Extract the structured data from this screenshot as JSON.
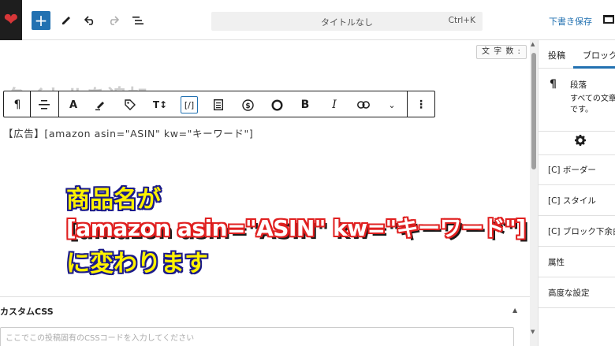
{
  "topbar": {
    "command_title": "タイトルなし",
    "shortcut": "Ctrl+K",
    "save_draft": "下書き保存"
  },
  "editor": {
    "word_count_label": "文 字 数 :",
    "title_placeholder": "タイトルを追加",
    "shortcode_text": "【広告】[amazon asin=\"ASIN\" kw=\"キーワード\"]"
  },
  "block_toolbar": {
    "items": [
      "paragraph",
      "align",
      "text-color",
      "highlighter",
      "tag",
      "font-size",
      "shortcode",
      "list",
      "currency",
      "circle",
      "bold",
      "italic",
      "link",
      "more",
      "options"
    ]
  },
  "overlay_caption": {
    "line1": "商品名が",
    "line2": "[amazon asin=\"ASIN\" kw=\"キーワード\"]",
    "line3": "に変わります"
  },
  "custom_css": {
    "label": "カスタムCSS",
    "placeholder": "ここでこの投稿固有のCSSコードを入力してください"
  },
  "sidebar": {
    "tab_post": "投稿",
    "tab_block": "ブロック",
    "block_name": "段落",
    "block_desc_1": "すべての文章",
    "block_desc_2": "です。",
    "panels": [
      "[C] ボーダー",
      "[C] スタイル",
      "[C] ブロック下余白",
      "属性",
      "高度な設定"
    ]
  },
  "colors": {
    "accent": "#2271b1",
    "caption_yellow": "#fff200",
    "caption_outline": "#e02020"
  }
}
